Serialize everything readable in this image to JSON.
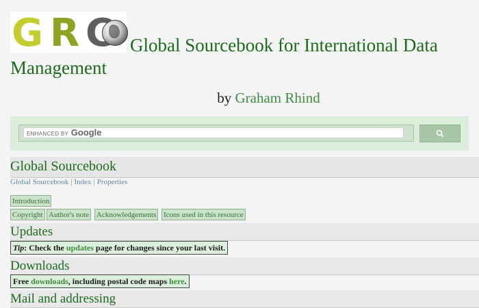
{
  "header": {
    "logo_letters": [
      "G",
      "R",
      "C"
    ],
    "title": "Global Sourcebook for International Data Management",
    "byline_prefix": "by",
    "author": "Graham Rhind"
  },
  "search": {
    "enhanced_by": "ENHANCED BY",
    "google": "Google",
    "button_icon": "search-icon"
  },
  "page": {
    "section_title": "Global Sourcebook",
    "breadcrumbs": [
      "Global Sourcebook",
      "Index",
      "Properties"
    ],
    "tabs": [
      "Introduction",
      "Copyright",
      "Author's note",
      "Acknowledgements",
      "Icons used in this resource"
    ]
  },
  "updates": {
    "heading": "Updates",
    "tip_label": "Tip",
    "tip_pre": ": Check the ",
    "tip_link": "updates",
    "tip_post": " page for changes since your last visit."
  },
  "downloads": {
    "heading": "Downloads",
    "pre": "Free ",
    "link1": "downloads",
    "mid": ", including postal code maps ",
    "link2": "here",
    "post": "."
  },
  "next_section": {
    "heading": "Mail and addressing"
  },
  "colors": {
    "title_green": "#1c6b1c",
    "link_green": "#3f8c3f",
    "band": "#dbeedb"
  }
}
